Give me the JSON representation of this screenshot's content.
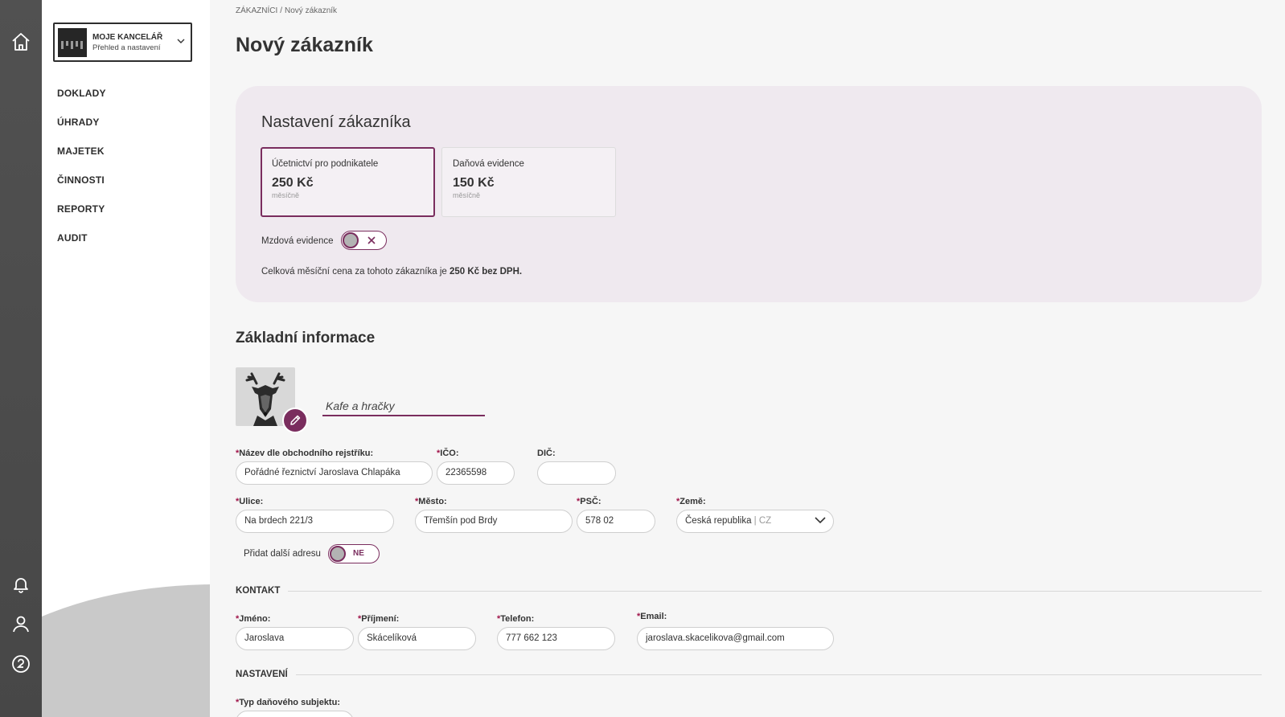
{
  "rail": {
    "top_icon": "home-icon",
    "bottom_icons": [
      "bell-icon",
      "user-icon",
      "help-icon"
    ]
  },
  "office": {
    "name": "MOJE KANCELÁŘ",
    "subtitle": "Přehled a nastavení"
  },
  "nav": {
    "items": [
      "DOKLADY",
      "ÚHRADY",
      "MAJETEK",
      "ČINNOSTI",
      "REPORTY",
      "AUDIT"
    ]
  },
  "breadcrumb": {
    "parent": "ZÁKAZNÍCI",
    "separator": "/",
    "current": "Nový zákazník"
  },
  "page_title": "Nový zákazník",
  "settings": {
    "title": "Nastavení zákazníka",
    "plans": [
      {
        "name": "Účetnictví pro podnikatele",
        "price": "250 Kč",
        "period": "měsíčně",
        "selected": true
      },
      {
        "name": "Daňová evidence",
        "price": "150 Kč",
        "period": "měsíčně",
        "selected": false
      }
    ],
    "payroll_label": "Mzdová evidence",
    "payroll_enabled": false,
    "total_prefix": "Celková měsíční cena za tohoto zákazníka je ",
    "total_value": "250 Kč bez DPH."
  },
  "basic": {
    "title": "Základní informace",
    "nickname": "Kafe a hračky",
    "fields": {
      "company_label": "Název dle obchodního rejstříku:",
      "company_value": "Pořádné řeznictví Jaroslava Chlapáka",
      "ico_label": "IČO:",
      "ico_value": "22365598",
      "dic_label": "DIČ:",
      "dic_value": "",
      "street_label": "Ulice:",
      "street_value": "Na brdech 221/3",
      "city_label": "Město:",
      "city_value": "Třemšín pod Brdy",
      "zip_label": "PSČ:",
      "zip_value": "578 02",
      "country_label": "Země:",
      "country_value": "Česká republika",
      "country_code": "| CZ"
    },
    "add_address_label": "Přidat další adresu",
    "add_address_value": "NE"
  },
  "contact": {
    "title": "KONTAKT",
    "first_name_label": "Jméno:",
    "first_name_value": "Jaroslava",
    "last_name_label": "Příjmení:",
    "last_name_value": "Skácelíková",
    "phone_label": "Telefon:",
    "phone_value": "777 662 123",
    "email_label": "Email:",
    "email_value": "jaroslava.skacelikova@gmail.com"
  },
  "settings_section": {
    "title": "NASTAVENÍ",
    "tax_type_label": "Typ daňového subjektu:"
  },
  "colors": {
    "accent": "#7a2d5e",
    "required": "#a0154a",
    "rail": "#4d4d4d",
    "card": "#efe9ef"
  }
}
